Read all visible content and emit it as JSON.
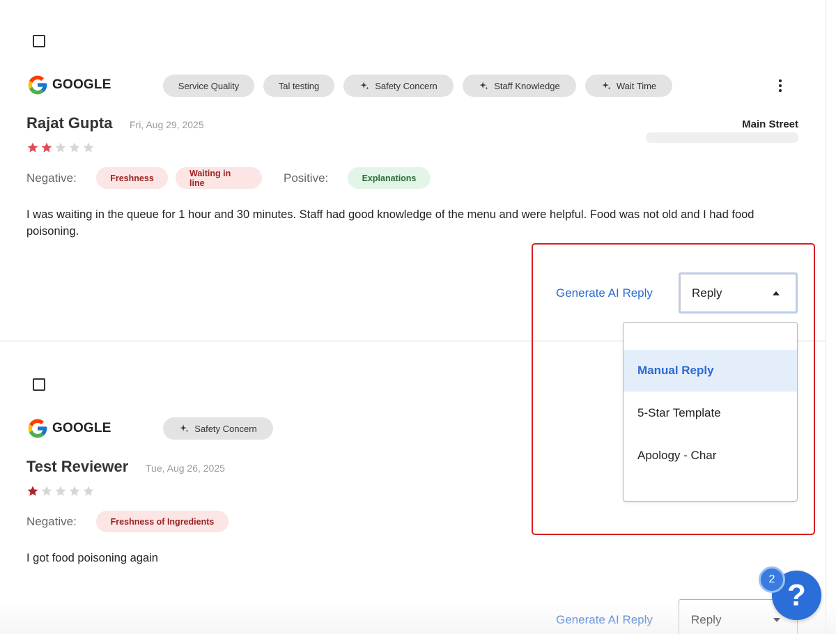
{
  "reviews": [
    {
      "source": "GOOGLE",
      "chips": [
        {
          "label": "Service Quality",
          "ai": false
        },
        {
          "label": "Tal testing",
          "ai": false
        },
        {
          "label": "Safety Concern",
          "ai": true
        },
        {
          "label": "Staff Knowledge",
          "ai": true
        },
        {
          "label": "Wait Time",
          "ai": true
        }
      ],
      "reviewer": "Rajat Gupta",
      "date": "Fri, Aug 29, 2025",
      "rating": 2,
      "location": "Main Street",
      "negative_label": "Negative:",
      "negative_tags": [
        "Freshness",
        "Waiting in line"
      ],
      "positive_label": "Positive:",
      "positive_tags": [
        "Explanations"
      ],
      "text": "I was waiting in the queue for 1 hour and 30 minutes. Staff had good knowledge of the menu and were helpful. Food was not old and I had food poisoning.",
      "generate_ai_reply": "Generate AI Reply",
      "reply_select_value": "Reply",
      "reply_menu_open": true
    },
    {
      "source": "GOOGLE",
      "chips": [
        {
          "label": "Safety Concern",
          "ai": true
        }
      ],
      "reviewer": "Test Reviewer",
      "date": "Tue, Aug 26, 2025",
      "rating": 1,
      "negative_label": "Negative:",
      "negative_tags": [
        "Freshness of Ingredients"
      ],
      "text": "I got food poisoning again",
      "generate_ai_reply": "Generate AI Reply",
      "reply_select_value": "Reply",
      "reply_menu_open": false
    }
  ],
  "reply_menu": {
    "options": [
      "Manual Reply",
      "5-Star Template",
      "Apology - Char"
    ],
    "highlighted": "Manual Reply"
  },
  "help": {
    "symbol": "?",
    "badge_count": "2"
  },
  "colors": {
    "accent": "#2a6ad3",
    "highlight_border": "#d71e22",
    "star_filled_review1": "#e04a5a",
    "star_filled_review2": "#b4202a",
    "star_empty": "#d6d6d6",
    "negative_tag_bg": "#fbe5e5",
    "negative_tag_text": "#9c2323",
    "positive_tag_bg": "#e2f5e7",
    "positive_tag_text": "#2d6b3b"
  },
  "icons": {
    "source_logo": "google-logo-icon",
    "chip_ai": "sparkle-icon",
    "more_menu": "more-vertical-icon",
    "select_caret_open": "caret-up-icon",
    "select_caret_closed": "caret-down-icon",
    "star": "star-icon",
    "help": "help-icon"
  }
}
